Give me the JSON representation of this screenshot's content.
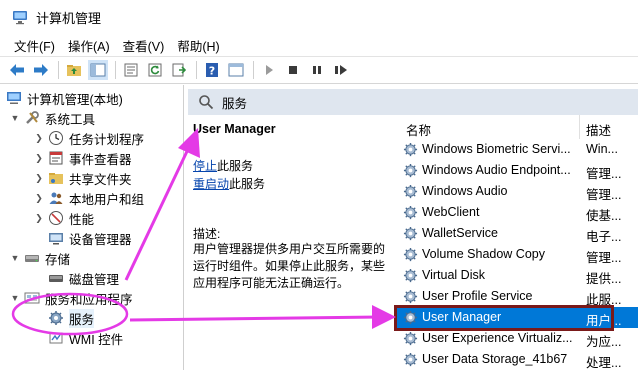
{
  "window": {
    "title": "计算机管理"
  },
  "menu": [
    "文件(F)",
    "操作(A)",
    "查看(V)",
    "帮助(H)"
  ],
  "toolbar": {
    "icons": [
      "back-arrow-icon",
      "forward-arrow-icon",
      "up-folder-icon",
      "show-hide-tree-icon",
      "properties-icon",
      "refresh-icon",
      "export-icon",
      "help-icon",
      "console-icon",
      "play-icon",
      "stop-icon",
      "pause-icon",
      "restart-icon"
    ]
  },
  "tree": {
    "root": "计算机管理(本地)",
    "system_tools": "系统工具",
    "task_scheduler": "任务计划程序",
    "event_viewer": "事件查看器",
    "shared_folders": "共享文件夹",
    "local_users": "本地用户和组",
    "performance": "性能",
    "device_manager": "设备管理器",
    "storage": "存储",
    "disk_management": "磁盘管理",
    "services_apps": "服务和应用程序",
    "services": "服务",
    "wmi": "WMI 控件"
  },
  "services_panel": {
    "header": "服务",
    "selected_title": "User Manager",
    "stop_link": "停止",
    "stop_suffix": "此服务",
    "restart_link": "重启动",
    "restart_suffix": "此服务",
    "desc_label": "描述:",
    "desc_lines": [
      "用户管理器提供多用户交互所需要的",
      "运行时组件。如果停止此服务，某些",
      "应用程序可能无法正确运行。"
    ]
  },
  "list": {
    "col_name": "名称",
    "col_desc": "描述",
    "rows": [
      {
        "name": "Windows Biometric Servi...",
        "desc": "Win..."
      },
      {
        "name": "Windows Audio Endpoint...",
        "desc": "管理..."
      },
      {
        "name": "Windows Audio",
        "desc": "管理..."
      },
      {
        "name": "WebClient",
        "desc": "使基..."
      },
      {
        "name": "WalletService",
        "desc": "电子..."
      },
      {
        "name": "Volume Shadow Copy",
        "desc": "管理..."
      },
      {
        "name": "Virtual Disk",
        "desc": "提供..."
      },
      {
        "name": "User Profile Service",
        "desc": "此服..."
      },
      {
        "name": "User Manager",
        "desc": "用户..."
      },
      {
        "name": "User Experience Virtualiz...",
        "desc": "为应..."
      },
      {
        "name": "User Data Storage_41b67",
        "desc": "处理..."
      }
    ],
    "selected_index": 8
  },
  "colors": {
    "selection": "#0078d7",
    "header_bg": "#dfe6ef",
    "annotation": "#e43ae6",
    "highlight_border": "#7a1a1a",
    "link": "#0645ad"
  }
}
